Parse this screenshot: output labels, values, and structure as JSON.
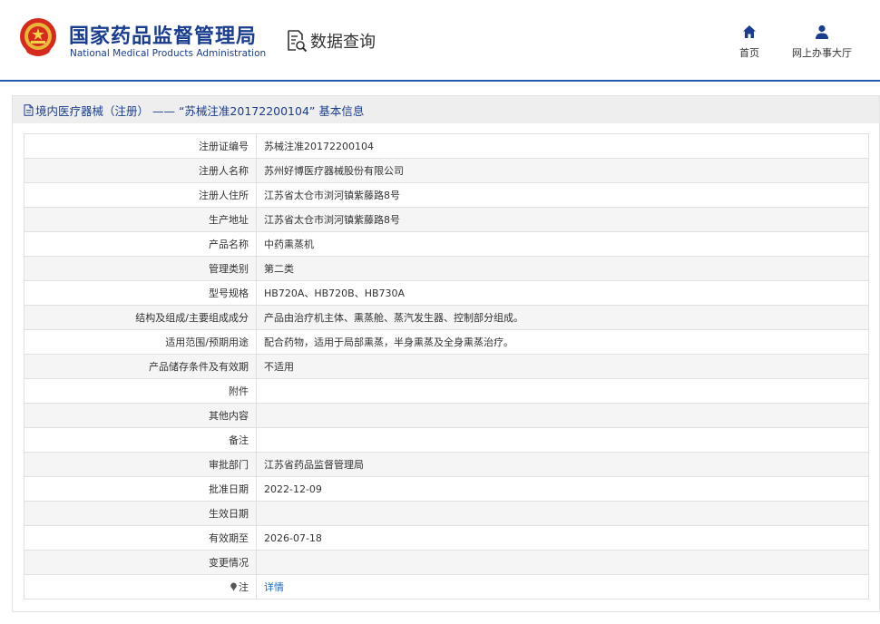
{
  "header": {
    "site_name": "国家药品监督管理局",
    "site_name_en": "National Medical Products Administration",
    "query_label": "数据查询",
    "nav": [
      {
        "label": "首页",
        "icon": "home-icon"
      },
      {
        "label": "网上办事大厅",
        "icon": "user-icon"
      }
    ]
  },
  "panel": {
    "title": "境内医疗器械（注册） —— “苏械注准20172200104” 基本信息"
  },
  "rows": [
    {
      "label": "注册证编号",
      "value": "苏械注准20172200104"
    },
    {
      "label": "注册人名称",
      "value": "苏州好博医疗器械股份有限公司"
    },
    {
      "label": "注册人住所",
      "value": "江苏省太仓市浏河镇紫藤路8号"
    },
    {
      "label": "生产地址",
      "value": "江苏省太仓市浏河镇紫藤路8号"
    },
    {
      "label": "产品名称",
      "value": "中药熏蒸机"
    },
    {
      "label": "管理类别",
      "value": "第二类"
    },
    {
      "label": "型号规格",
      "value": "HB720A、HB720B、HB730A"
    },
    {
      "label": "结构及组成/主要组成成分",
      "value": "产品由治疗机主体、熏蒸舱、蒸汽发生器、控制部分组成。"
    },
    {
      "label": "适用范围/预期用途",
      "value": "配合药物，适用于局部熏蒸，半身熏蒸及全身熏蒸治疗。"
    },
    {
      "label": "产品储存条件及有效期",
      "value": "不适用"
    },
    {
      "label": "附件",
      "value": ""
    },
    {
      "label": "其他内容",
      "value": ""
    },
    {
      "label": "备注",
      "value": ""
    },
    {
      "label": "审批部门",
      "value": "江苏省药品监督管理局"
    },
    {
      "label": "批准日期",
      "value": "2022-12-09"
    },
    {
      "label": "生效日期",
      "value": ""
    },
    {
      "label": "有效期至",
      "value": "2026-07-18"
    },
    {
      "label": "变更情况",
      "value": ""
    }
  ],
  "note_row": {
    "label": "注",
    "link": "详情"
  },
  "colors": {
    "brand": "#1a3d8f",
    "link": "#1e6bc4",
    "rule": "#1e5aa8"
  }
}
